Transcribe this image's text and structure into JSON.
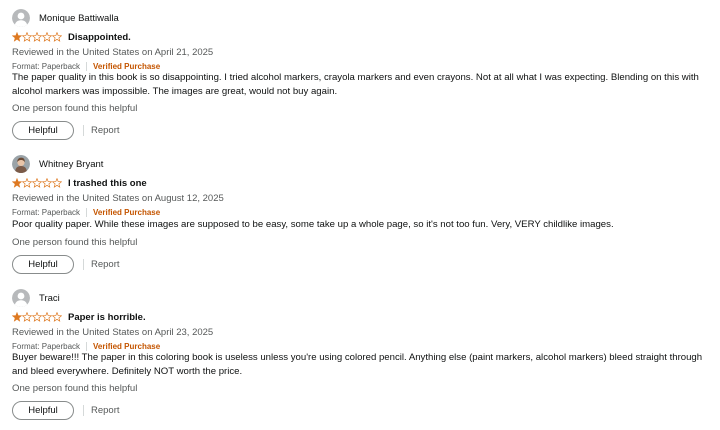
{
  "reviews": [
    {
      "name": "Monique Battiwalla",
      "avatar": "default-avatar-icon",
      "rating": 1,
      "max_rating": 5,
      "title": "Disappointed.",
      "date": "Reviewed in the United States on April 21, 2025",
      "format": "Format: Paperback",
      "verified": "Verified Purchase",
      "body": "The paper quality in this book is so disappointing. I tried alcohol markers, crayola markers and even crayons. Not at all what I was expecting. Blending on this with alcohol markers was impossible. The images are great, would not buy again.",
      "helpful_text": "One person found this helpful",
      "helpful_label": "Helpful",
      "report_label": "Report"
    },
    {
      "name": "Whitney Bryant",
      "avatar": "photo-avatar-icon",
      "rating": 1,
      "max_rating": 5,
      "title": "I trashed this one",
      "date": "Reviewed in the United States on August 12, 2025",
      "format": "Format: Paperback",
      "verified": "Verified Purchase",
      "body": "Poor quality paper. While these images are supposed to be easy, some take up a whole page, so it's not too fun. Very, VERY childlike images.",
      "helpful_text": "One person found this helpful",
      "helpful_label": "Helpful",
      "report_label": "Report"
    },
    {
      "name": "Traci",
      "avatar": "default-avatar-icon",
      "rating": 1,
      "max_rating": 5,
      "title": "Paper is horrible.",
      "date": "Reviewed in the United States on April 23, 2025",
      "format": "Format: Paperback",
      "verified": "Verified Purchase",
      "body": "Buyer beware!!! The paper in this coloring book is useless unless you're using colored pencil. Anything else (paint markers, alcohol markers) bleed straight through and bleed everywhere. Definitely NOT worth the price.",
      "helpful_text": "One person found this helpful",
      "helpful_label": "Helpful",
      "report_label": "Report"
    }
  ],
  "colors": {
    "star_fill": "#de7921",
    "verified": "#c45500",
    "muted_text": "#565959",
    "text": "#0f1111"
  }
}
